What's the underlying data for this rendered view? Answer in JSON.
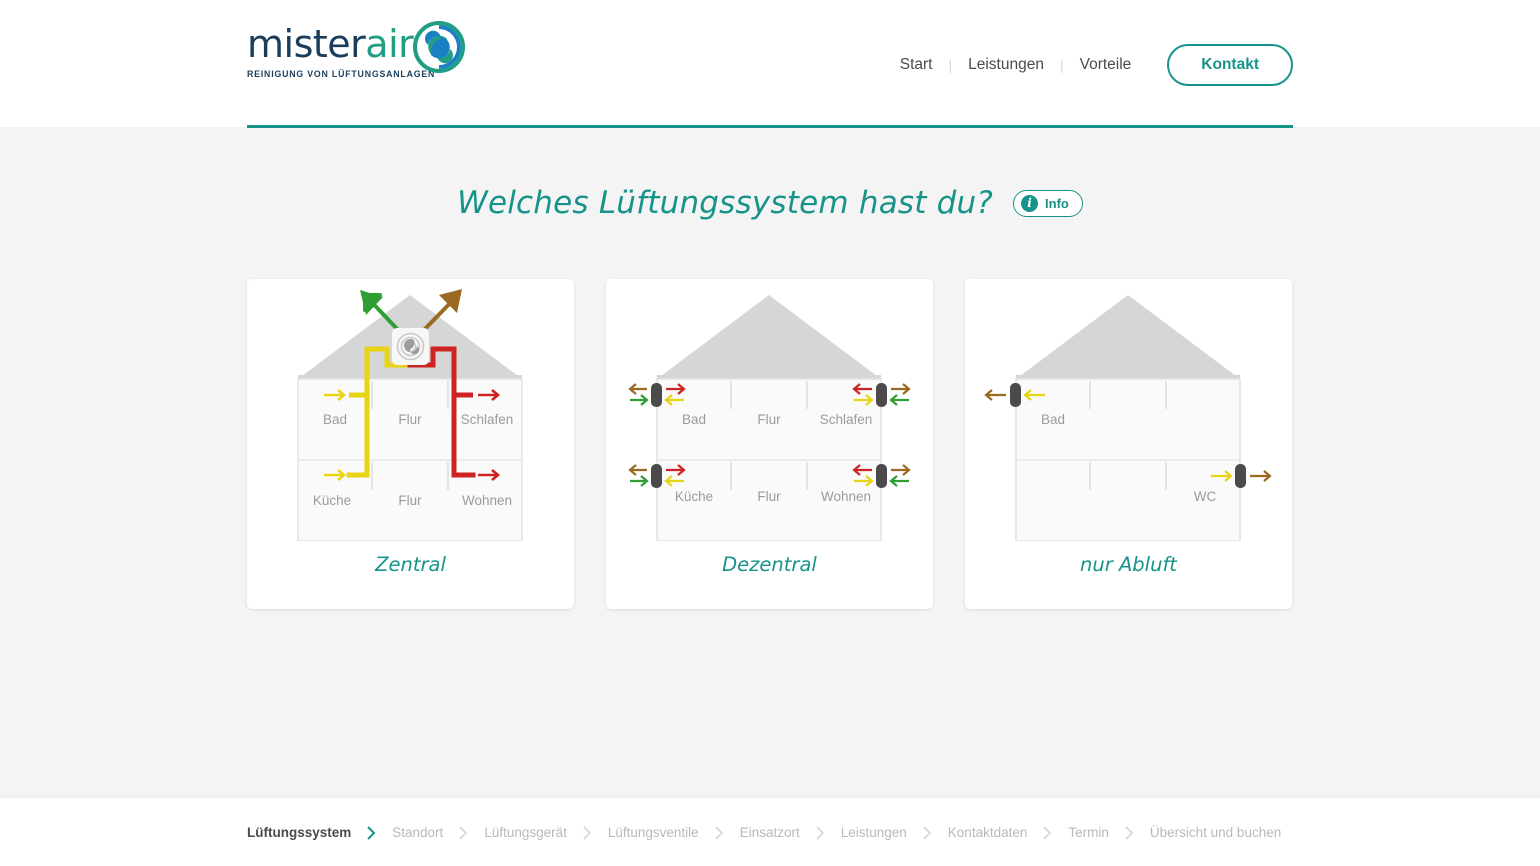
{
  "brand": {
    "logo_word_part1": "mister",
    "logo_word_part2": "air",
    "logo_tagline": "REINIGUNG VON LÜFTUNGSANLAGEN",
    "accent_color": "#17948a",
    "navy_color": "#1b3d5c",
    "green_color": "#1f9e84"
  },
  "nav": {
    "items": [
      {
        "label": "Start"
      },
      {
        "label": "Leistungen"
      },
      {
        "label": "Vorteile"
      }
    ],
    "separator": "|",
    "cta_label": "Kontakt"
  },
  "progress": {
    "percent": 100,
    "fill_color": "#17948a"
  },
  "main": {
    "headline": "Welches Lüftungssystem hast du?",
    "info_badge": {
      "icon": "info-icon",
      "glyph": "i",
      "label": "Info"
    },
    "cards": [
      {
        "id": "zentral",
        "label": "Zentral",
        "diagram": "central-ventilation-house",
        "rooms_upper": [
          "Bad",
          "Flur",
          "Schlafen"
        ],
        "rooms_lower": [
          "Küche",
          "Flur",
          "Wohnen"
        ],
        "duct_exhaust_color": "#e8d417",
        "duct_supply_color": "#cf2222",
        "arrow_intake_color": "#2f9e35",
        "arrow_outlet_color": "#9a6a23",
        "unit": "central-unit-spiral"
      },
      {
        "id": "dezentral",
        "label": "Dezentral",
        "diagram": "decentral-ventilation-house",
        "rooms_upper": [
          "Bad",
          "Flur",
          "Schlafen"
        ],
        "rooms_lower": [
          "Küche",
          "Flur",
          "Wohnen"
        ],
        "unit_color": "#4a4a4a",
        "arrow_colors": {
          "outside_out": "#9a6a23",
          "outside_in": "#2f9e35",
          "inside_in": "#cf2222",
          "inside_out": "#e8d417"
        },
        "unit_count": 4
      },
      {
        "id": "nur-abluft",
        "label": "nur Abluft",
        "diagram": "exhaust-only-house",
        "rooms_upper": [
          "Bad",
          "",
          ""
        ],
        "rooms_lower": [
          "",
          "",
          "WC"
        ],
        "unit_color": "#4a4a4a",
        "arrow_exhaust_color": "#e8d417",
        "arrow_outside_color": "#9a6a23",
        "unit_count": 2
      }
    ]
  },
  "footer": {
    "steps": [
      {
        "label": "Lüftungssystem",
        "active": true
      },
      {
        "label": "Standort",
        "active": false
      },
      {
        "label": "Lüftungsgerät",
        "active": false
      },
      {
        "label": "Lüftungsventile",
        "active": false
      },
      {
        "label": "Einsatzort",
        "active": false
      },
      {
        "label": "Leistungen",
        "active": false
      },
      {
        "label": "Kontaktdaten",
        "active": false
      },
      {
        "label": "Termin",
        "active": false
      },
      {
        "label": "Übersicht und buchen",
        "active": false
      }
    ]
  }
}
